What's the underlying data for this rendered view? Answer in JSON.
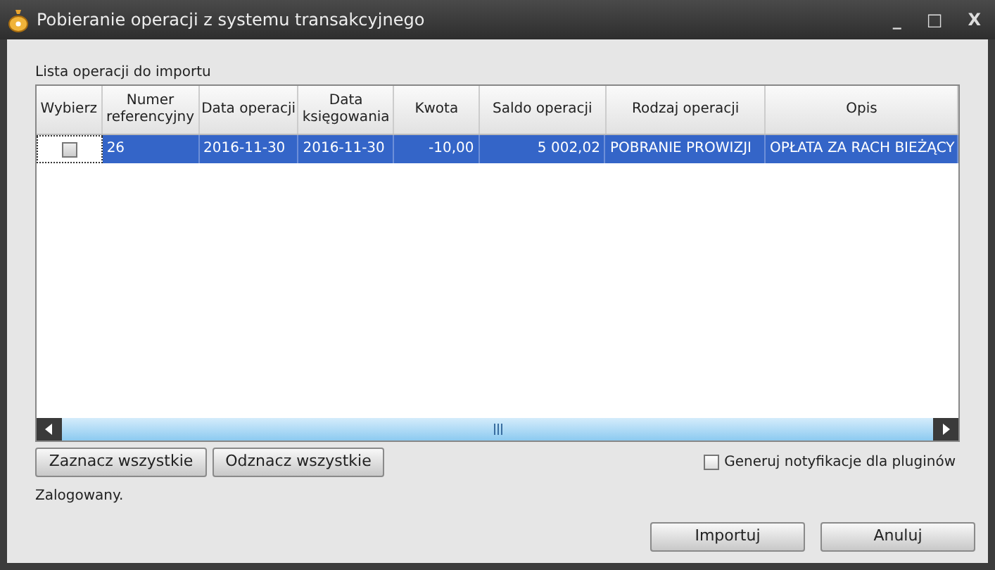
{
  "window": {
    "title": "Pobieranie operacji z systemu transakcyjnego",
    "controls": [
      "_",
      "□",
      "X"
    ]
  },
  "list_label": "Lista operacji do importu",
  "table": {
    "columns": [
      "Wybierz",
      "Numer referencyjny",
      "Data operacji",
      "Data księgowania",
      "Kwota",
      "Saldo operacji",
      "Rodzaj operacji",
      "Opis"
    ],
    "rows": [
      {
        "selected": true,
        "cells": [
          {
            "kind": "checkbox",
            "checked": false
          },
          "26",
          "2016-11-30",
          "2016-11-30",
          "-10,00",
          "5 002,02",
          "POBRANIE PROWIZJI",
          "OPŁATA ZA RACH BIEŻĄCY"
        ]
      }
    ]
  },
  "select_buttons": [
    "Zaznacz wszystkie",
    "Odznacz wszystkie"
  ],
  "notify_option": {
    "label": "Generuj notyfikacje dla pluginów",
    "checked": false
  },
  "status": "Zalogowany.",
  "buttons": [
    "Importuj",
    "Anuluj"
  ]
}
